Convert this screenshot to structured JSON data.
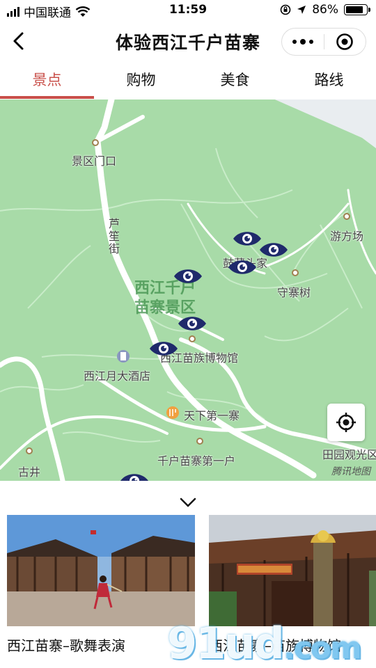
{
  "status_bar": {
    "carrier": "中国联通",
    "time": "11:59",
    "battery_percent": "86%",
    "battery_level": 0.86
  },
  "nav": {
    "title": "体验西江千户苗寨"
  },
  "tabs": [
    {
      "label": "景点",
      "active": true
    },
    {
      "label": "购物",
      "active": false
    },
    {
      "label": "美食",
      "active": false
    },
    {
      "label": "路线",
      "active": false
    }
  ],
  "map": {
    "area_label": "西江千户苗寨景区",
    "street_label": "芦笙街",
    "attribution": "腾讯地图",
    "places": {
      "scenic_gate": "景区门口",
      "youfang": "游方场",
      "gufang": "鼓藏头家",
      "shouzhai": "守寨树",
      "museum": "西江苗族博物馆",
      "hotel": "西江月大酒店",
      "tianxia": "天下第一寨",
      "qianhu": "千户苗寨第一户",
      "gujing": "古井",
      "tianyuan": "田园观光区"
    },
    "colors": {
      "park": "#a8dba8",
      "road": "#ffffff",
      "marker": "#1f2a6b",
      "accent": "#c9504a"
    }
  },
  "cards": [
    {
      "title": "西江苗寨–歌舞表演"
    },
    {
      "title": "西江苗寨–苗族博物馆"
    }
  ],
  "watermark": {
    "text": "9",
    "text2": "1ud",
    "text3": ".com"
  }
}
